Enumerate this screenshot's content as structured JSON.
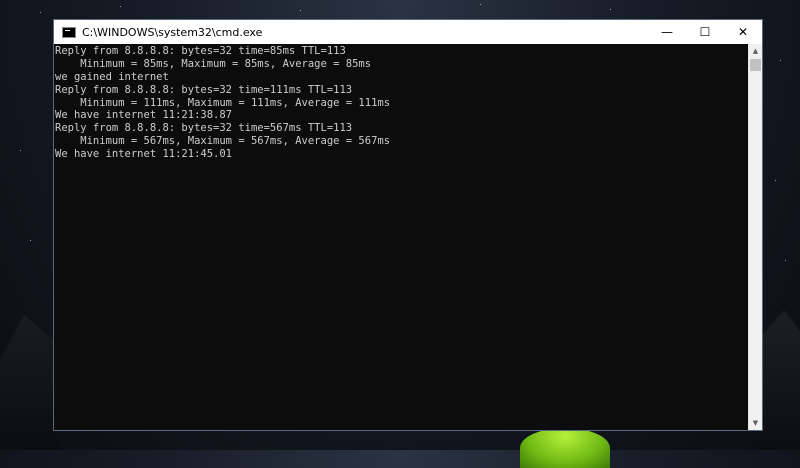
{
  "window": {
    "title": "C:\\WINDOWS\\system32\\cmd.exe",
    "minimize_glyph": "—",
    "maximize_glyph": "☐",
    "close_glyph": "✕"
  },
  "console": {
    "lines": [
      "Reply from 8.8.8.8: bytes=32 time=85ms TTL=113",
      "    Minimum = 85ms, Maximum = 85ms, Average = 85ms",
      "we gained internet",
      "Reply from 8.8.8.8: bytes=32 time=111ms TTL=113",
      "    Minimum = 111ms, Maximum = 111ms, Average = 111ms",
      "We have internet 11:21:38.87",
      "Reply from 8.8.8.8: bytes=32 time=567ms TTL=113",
      "    Minimum = 567ms, Maximum = 567ms, Average = 567ms",
      "We have internet 11:21:45.01"
    ]
  },
  "scrollbar": {
    "up_glyph": "▲",
    "down_glyph": "▼"
  },
  "icons": {
    "app": "cmd-icon",
    "minimize": "minimize-icon",
    "maximize": "maximize-icon",
    "close": "close-icon"
  },
  "colors": {
    "console_bg": "#0c0c0c",
    "console_text": "#cccccc",
    "titlebar_bg": "#ffffff"
  }
}
